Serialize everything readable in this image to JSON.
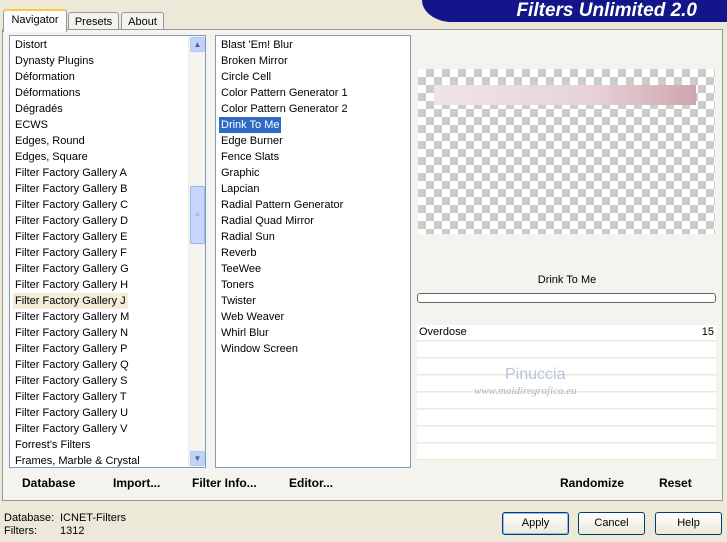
{
  "app": {
    "title": "Filters Unlimited 2.0"
  },
  "tabs": [
    {
      "label": "Navigator",
      "active": true
    },
    {
      "label": "Presets",
      "active": false
    },
    {
      "label": "About",
      "active": false
    }
  ],
  "categories": {
    "items": [
      "Distort",
      "Dynasty Plugins",
      "Déformation",
      "Déformations",
      "Dégradés",
      "ECWS",
      "Edges, Round",
      "Edges, Square",
      "Filter Factory Gallery A",
      "Filter Factory Gallery B",
      "Filter Factory Gallery C",
      "Filter Factory Gallery D",
      "Filter Factory Gallery E",
      "Filter Factory Gallery F",
      "Filter Factory Gallery G",
      "Filter Factory Gallery H",
      "Filter Factory Gallery J",
      "Filter Factory Gallery M",
      "Filter Factory Gallery N",
      "Filter Factory Gallery P",
      "Filter Factory Gallery Q",
      "Filter Factory Gallery S",
      "Filter Factory Gallery T",
      "Filter Factory Gallery U",
      "Filter Factory Gallery V",
      "Forrest's Filters",
      "Frames, Marble & Crystal"
    ],
    "selected": "Filter Factory Gallery J"
  },
  "filters": {
    "items": [
      "Blast 'Em! Blur",
      "Broken Mirror",
      "Circle Cell",
      "Color Pattern Generator 1",
      "Color Pattern Generator 2",
      "Drink To Me",
      "Edge Burner",
      "Fence Slats",
      "Graphic",
      "Lapcian",
      "Radial Pattern Generator",
      "Radial Quad Mirror",
      "Radial Sun",
      "Reverb",
      "TeeWee",
      "Toners",
      "Twister",
      "Web Weaver",
      "Whirl Blur",
      "Window Screen"
    ],
    "selected": "Drink To Me"
  },
  "preview": {
    "filter_name": "Drink To Me"
  },
  "parameters": [
    {
      "label": "Overdose",
      "value": "15"
    }
  ],
  "watermark": {
    "name": "Pinuccia",
    "url": "www.maidiregrafica.eu"
  },
  "commands": {
    "database": "Database",
    "import": "Import...",
    "filter_info": "Filter Info...",
    "editor": "Editor...",
    "randomize": "Randomize",
    "reset": "Reset"
  },
  "status": {
    "database_label": "Database:",
    "database_value": "ICNET-Filters",
    "filters_label": "Filters:",
    "filters_value": "1312"
  },
  "buttons": {
    "apply": "Apply",
    "cancel": "Cancel",
    "help": "Help"
  },
  "colors": {
    "banner": "#12168a",
    "selection": "#316ac5"
  },
  "icons": {
    "scroll_up": "scroll-up-arrow-icon",
    "scroll_down": "scroll-down-arrow-icon",
    "scroll_thumb": "scroll-thumb-grip-icon"
  }
}
